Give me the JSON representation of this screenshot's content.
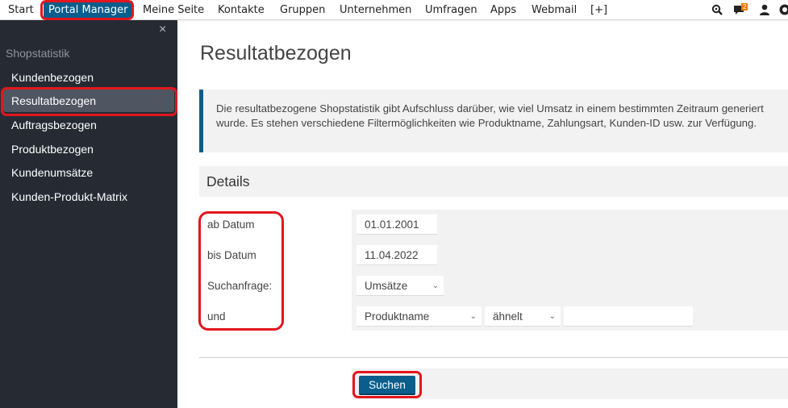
{
  "topnav": {
    "items": [
      {
        "label": "Start"
      },
      {
        "label": "Portal Manager",
        "active": true
      },
      {
        "label": "Meine Seite"
      },
      {
        "label": "Kontakte"
      },
      {
        "label": "Gruppen"
      },
      {
        "label": "Unternehmen"
      },
      {
        "label": "Umfragen"
      },
      {
        "label": "Apps"
      },
      {
        "label": "Webmail"
      },
      {
        "label": "[+]"
      }
    ],
    "icons": [
      "search-icon",
      "messages-icon",
      "user-icon",
      "help-icon"
    ],
    "messages_badge": "2"
  },
  "sidebar": {
    "close_label": "×",
    "section_title": "Shopstatistik",
    "items": [
      {
        "label": "Kundenbezogen"
      },
      {
        "label": "Resultatbezogen",
        "active": true
      },
      {
        "label": "Auftragsbezogen"
      },
      {
        "label": "Produktbezogen"
      },
      {
        "label": "Kundenumsätze"
      },
      {
        "label": "Kunden-Produkt-Matrix"
      }
    ]
  },
  "main": {
    "title": "Resultatbezogen",
    "info_text": "Die resultatbezogene Shopstatistik gibt Aufschluss darüber, wie viel Umsatz in einem bestimmten Zeitraum generiert wurde. Es stehen verschiedene Filtermöglichkeiten wie Produktname, Zahlungsart, Kunden-ID usw. zur Verfügung.",
    "details_heading": "Details",
    "form": {
      "from_date_label": "ab Datum",
      "from_date_value": "01.01.2001",
      "to_date_label": "bis Datum",
      "to_date_value": "11.04.2022",
      "query_label": "Suchanfrage:",
      "query_value": "Umsätze",
      "and_label": "und",
      "filter_field_value": "Produktname",
      "filter_operator_value": "ähnelt",
      "filter_text_value": ""
    },
    "search_button": "Suchen"
  },
  "colors": {
    "accent": "#0a5e8c",
    "sidebar_bg": "#262b33",
    "sidebar_active": "#505661",
    "highlight": "#e3161e",
    "badge": "#f07c00"
  }
}
